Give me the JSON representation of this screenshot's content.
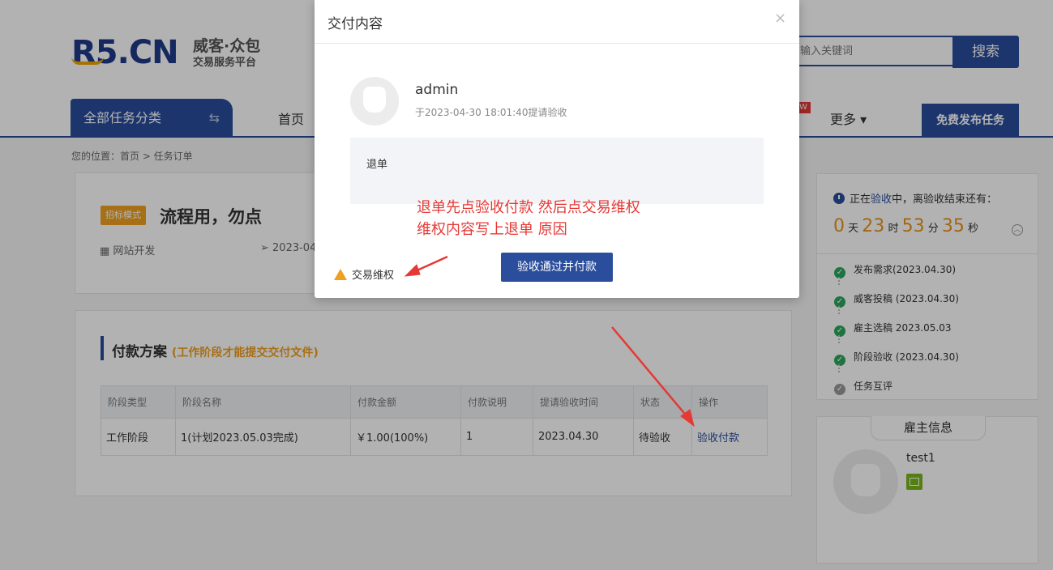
{
  "header": {
    "logo_mark": "R5.CN",
    "logo_name": "威客·众包",
    "logo_sub": "交易服务平台",
    "search_placeholder": "输入关键词",
    "search_button": "搜索",
    "category_tab": "全部任务分类",
    "nav_home": "首页",
    "nav_badge": "W",
    "nav_more": "更多 ▾",
    "publish_button": "免费发布任务"
  },
  "breadcrumb": "您的位置：首页 > 任务订单",
  "task": {
    "mode_badge": "招标模式",
    "title": "流程用，勿点",
    "category": "网站开发",
    "date": "2023-04"
  },
  "payment": {
    "title": "付款方案",
    "note": "(工作阶段才能提交交付文件)",
    "columns": [
      "阶段类型",
      "阶段名称",
      "付款金额",
      "付款说明",
      "提请验收时间",
      "状态",
      "操作"
    ],
    "rows": [
      [
        "工作阶段",
        "1(计划2023.05.03完成)",
        "￥1.00(100%)",
        "1",
        "2023.04.30",
        "待验收",
        "验收付款"
      ]
    ]
  },
  "status_panel": {
    "prefix": "正在",
    "stage": "验收",
    "suffix": "中，离验收结束还有：",
    "days": "0",
    "days_unit": "天",
    "hours": "23",
    "hours_unit": "时",
    "minutes": "53",
    "minutes_unit": "分",
    "seconds": "35",
    "seconds_unit": "秒",
    "steps": [
      {
        "label": "发布需求(2023.04.30)",
        "done": true
      },
      {
        "label": "威客投稿 (2023.04.30)",
        "done": true
      },
      {
        "label": "雇主选稿 2023.05.03",
        "done": true
      },
      {
        "label": "阶段验收 (2023.04.30)",
        "done": true
      },
      {
        "label": "任务互评",
        "done": false
      }
    ]
  },
  "employer": {
    "heading": "雇主信息",
    "username": "test1"
  },
  "modal": {
    "title": "交付内容",
    "close": "×",
    "user": "admin",
    "time": "于2023-04-30 18:01:40提请验收",
    "content": "退单",
    "annotation_line1": "退单先点验收付款  然后点交易维权",
    "annotation_line2": "维权内容写上退单 原因",
    "dispute_link": "交易维权",
    "accept_button": "验收通过并付款"
  },
  "colors": {
    "brand": "#2a4d9c",
    "accent": "#f0a020",
    "annotation": "#e53935",
    "success": "#2aa65a"
  }
}
